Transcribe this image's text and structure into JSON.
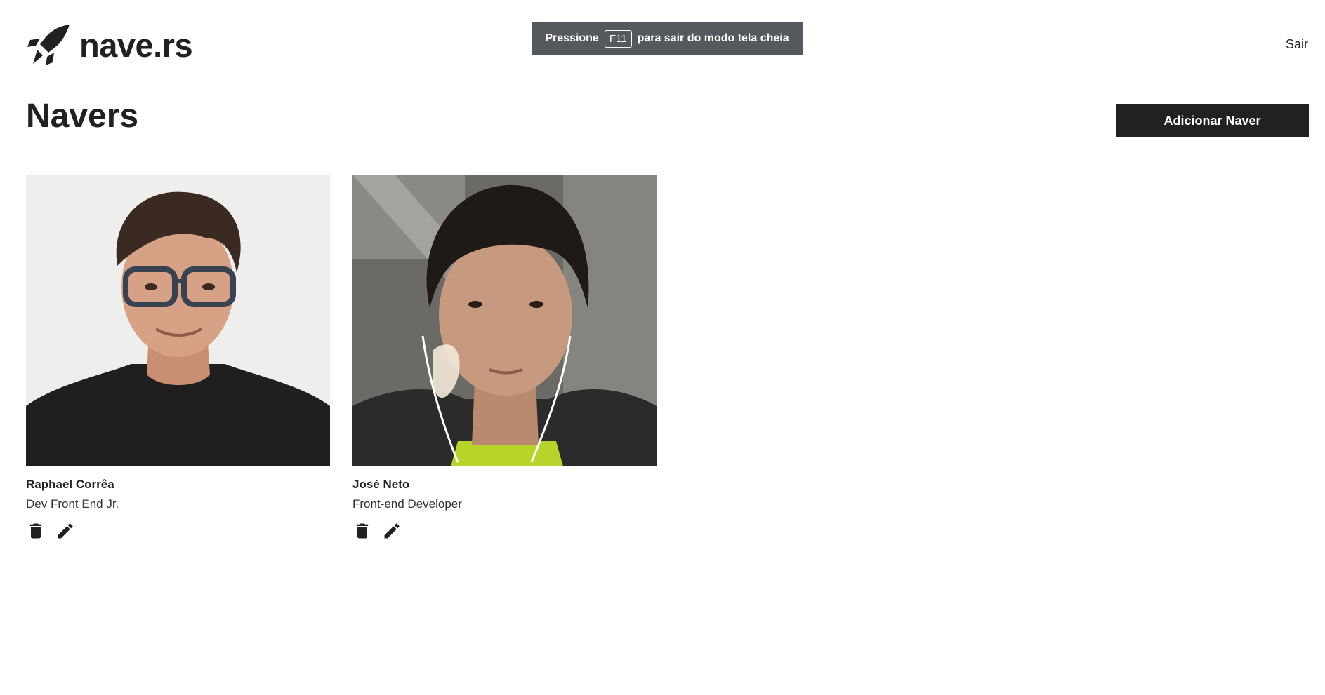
{
  "header": {
    "logo_text": "nave.rs",
    "logo_icon": "rocket-icon",
    "logout_label": "Sair"
  },
  "fullscreen_toast": {
    "before": "Pressione",
    "key": "F11",
    "after": "para sair do modo tela cheia"
  },
  "main": {
    "title": "Navers",
    "add_button_label": "Adicionar Naver",
    "navers": [
      {
        "name": "Raphael Corrêa",
        "role": "Dev Front End Jr.",
        "photo_icon": "naver-photo"
      },
      {
        "name": "José Neto",
        "role": "Front-end Developer",
        "photo_icon": "naver-photo"
      }
    ],
    "action_icons": [
      "trash-icon",
      "pencil-icon"
    ]
  },
  "colors": {
    "primary": "#212121",
    "background": "#ffffff",
    "toast_background": "#55585c"
  }
}
